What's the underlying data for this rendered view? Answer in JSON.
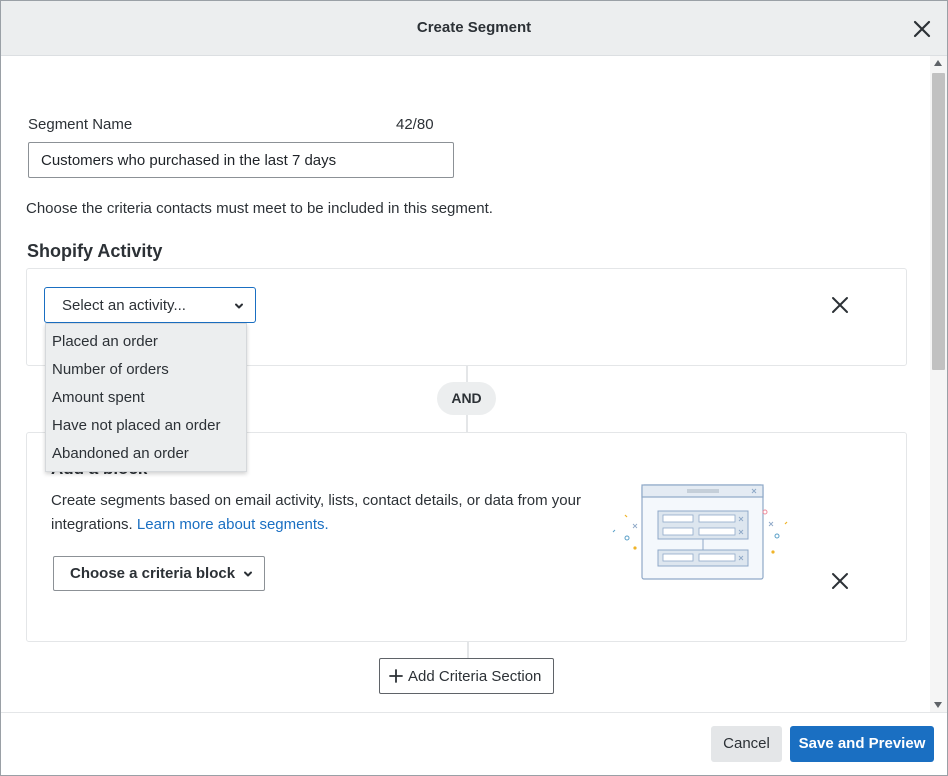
{
  "dialog": {
    "title": "Create Segment",
    "close_icon": "close-icon"
  },
  "segment_name": {
    "label": "Segment Name",
    "char_count": "42/80",
    "value": "Customers who purchased in the last 7 days"
  },
  "criteria_description": "Choose the criteria contacts must meet to be included in this segment.",
  "section": {
    "title": "Shopify Activity",
    "select_placeholder": "Select an activity...",
    "activity_options": [
      "Placed an order",
      "Number of orders",
      "Amount spent",
      "Have not placed an order",
      "Abandoned an order"
    ]
  },
  "connector": {
    "label": "AND"
  },
  "block": {
    "title": "Add a block",
    "description": "Create segments based on email activity, lists, contact details, or data from your integrations.",
    "link_text": "Learn more about segments.",
    "criteria_button": "Choose a criteria block"
  },
  "add_section_label": "Add Criteria Section",
  "footer": {
    "cancel_label": "Cancel",
    "save_label": "Save and Preview"
  },
  "colors": {
    "accent": "#1a6fc2",
    "header_bg": "#eceeef",
    "text": "#2c3136"
  }
}
